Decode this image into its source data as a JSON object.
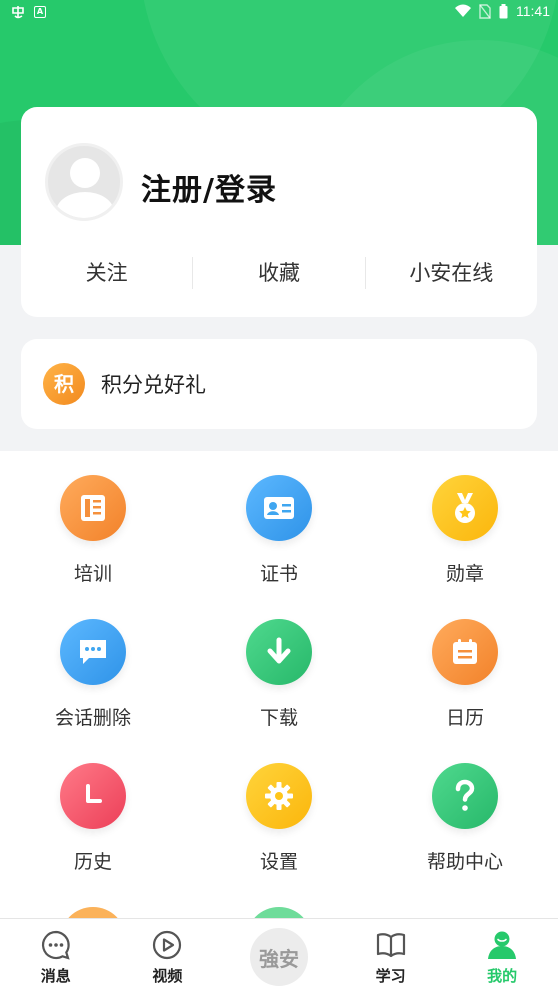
{
  "status_bar": {
    "time": "11:41"
  },
  "profile": {
    "login_title": "注册/登录",
    "stats": [
      {
        "label": "关注"
      },
      {
        "label": "收藏"
      },
      {
        "label": "小安在线"
      }
    ]
  },
  "points": {
    "icon_text": "积",
    "label": "积分兑好礼"
  },
  "grid": [
    {
      "label": "培训",
      "icon": "book-icon",
      "color": "#f5903c"
    },
    {
      "label": "证书",
      "icon": "certificate-icon",
      "color": "#3fa6f0"
    },
    {
      "label": "勋章",
      "icon": "medal-icon",
      "color": "#ffc61a"
    },
    {
      "label": "会话删除",
      "icon": "chat-bubble-icon",
      "color": "#3fa6f0"
    },
    {
      "label": "下载",
      "icon": "download-icon",
      "color": "#34c77b"
    },
    {
      "label": "日历",
      "icon": "calendar-icon",
      "color": "#f5903c"
    },
    {
      "label": "历史",
      "icon": "clock-icon",
      "color": "#f2546a"
    },
    {
      "label": "设置",
      "icon": "gear-icon",
      "color": "#ffc61a"
    },
    {
      "label": "帮助中心",
      "icon": "question-icon",
      "color": "#34c77b"
    }
  ],
  "tabs": [
    {
      "label": "消息",
      "icon": "message-icon"
    },
    {
      "label": "视频",
      "icon": "video-icon"
    },
    {
      "label": "",
      "center_text": "強安"
    },
    {
      "label": "学习",
      "icon": "open-book-icon"
    },
    {
      "label": "我的",
      "icon": "person-icon",
      "active": true
    }
  ],
  "colors": {
    "brand_green": "#26c96b"
  }
}
